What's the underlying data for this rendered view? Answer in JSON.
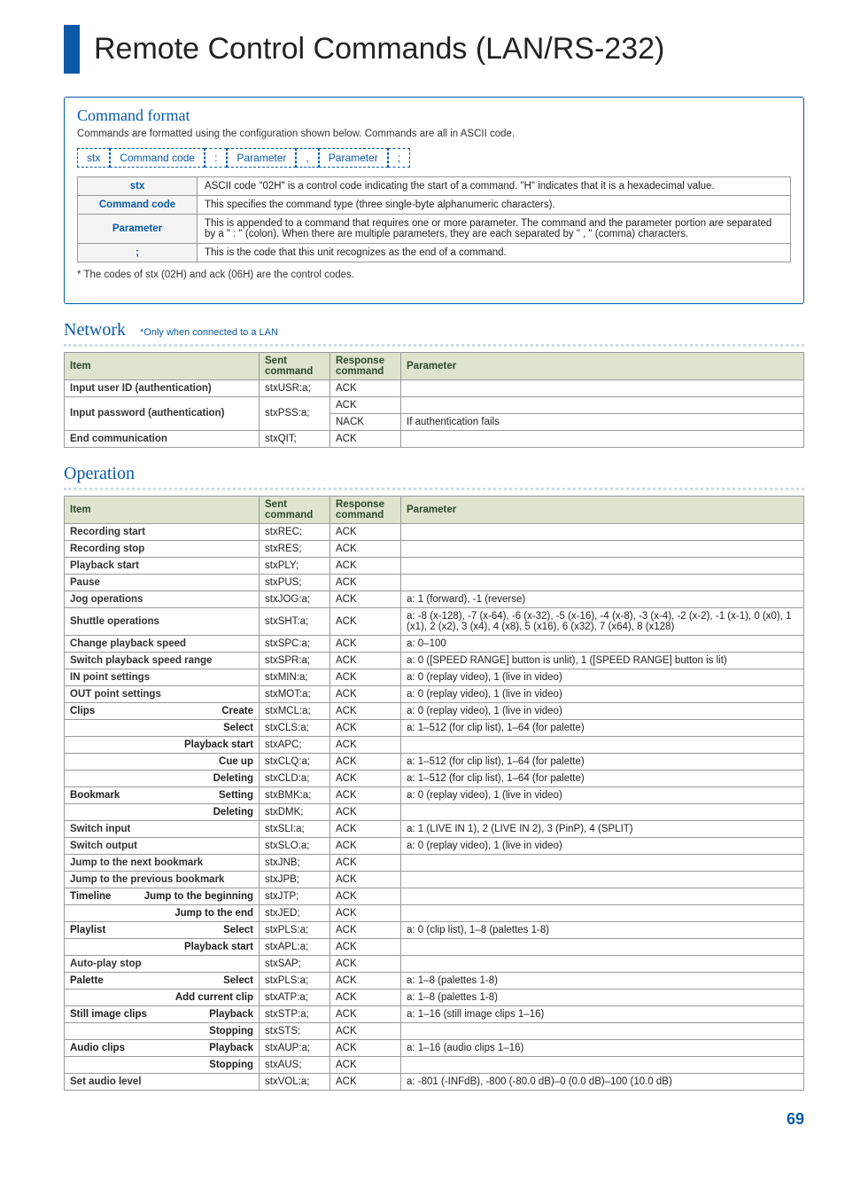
{
  "page_title": "Remote Control Commands (LAN/RS-232)",
  "page_number": "69",
  "cmd_format": {
    "heading": "Command format",
    "desc": "Commands are formatted using the configuration shown below. Commands are all in ASCII code.",
    "tokens": [
      "stx",
      "Command code",
      ":",
      "Parameter",
      ",",
      "Parameter",
      ";"
    ],
    "rows": [
      {
        "label": "stx",
        "text": "ASCII code \"02H\" is a control code indicating the start of a command. \"H\" indicates that it is a hexadecimal value."
      },
      {
        "label": "Command code",
        "text": "This specifies the command type (three single-byte alphanumeric characters)."
      },
      {
        "label": "Parameter",
        "text": "This is appended to a command that requires one or more parameter. The command and the parameter portion are separated by a \" : \" (colon). When there are multiple parameters, they are each separated by \" , \" (comma) characters."
      },
      {
        "label": ";",
        "text": "This is the code that this unit recognizes as the end of a command."
      }
    ],
    "footnote": "* The codes of stx (02H) and ack (06H) are the control codes."
  },
  "network": {
    "heading": "Network",
    "note": "*Only when connected to a LAN",
    "headers": [
      "Item",
      "Sent command",
      "Response command",
      "Parameter"
    ],
    "rows": [
      {
        "item": "Input user ID (authentication)",
        "sent": "stxUSR:a;",
        "resp": "ACK",
        "param": "",
        "rowspan": 1
      },
      {
        "item": "Input password (authentication)",
        "sent": "stxPSS:a;",
        "resp_rows": [
          {
            "resp": "ACK",
            "param": ""
          },
          {
            "resp": "NACK",
            "param": "If authentication fails"
          }
        ]
      },
      {
        "item": "End communication",
        "sent": "stxQIT;",
        "resp": "ACK",
        "param": "",
        "rowspan": 1
      }
    ]
  },
  "operation": {
    "heading": "Operation",
    "headers": [
      "Item",
      "Sent command",
      "Response command",
      "Parameter"
    ],
    "rows": [
      {
        "lead": "Recording start",
        "sub": "",
        "sent": "stxREC;",
        "resp": "ACK",
        "param": ""
      },
      {
        "lead": "Recording stop",
        "sub": "",
        "sent": "stxRES;",
        "resp": "ACK",
        "param": ""
      },
      {
        "lead": "Playback start",
        "sub": "",
        "sent": "stxPLY;",
        "resp": "ACK",
        "param": ""
      },
      {
        "lead": "Pause",
        "sub": "",
        "sent": "stxPUS;",
        "resp": "ACK",
        "param": ""
      },
      {
        "lead": "Jog operations",
        "sub": "",
        "sent": "stxJOG:a;",
        "resp": "ACK",
        "param": "a:  1 (forward), -1 (reverse)"
      },
      {
        "lead": "Shuttle operations",
        "sub": "",
        "sent": "stxSHT:a;",
        "resp": "ACK",
        "param": "a:  -8 (x-128), -7 (x-64), -6 (x-32), -5 (x-16), -4 (x-8), -3 (x-4), -2 (x-2), -1 (x-1), 0 (x0), 1 (x1), 2 (x2), 3 (x4), 4 (x8), 5 (x16), 6 (x32), 7 (x64), 8 (x128)"
      },
      {
        "lead": "Change playback speed",
        "sub": "",
        "sent": "stxSPC:a;",
        "resp": "ACK",
        "param": "a:  0–100"
      },
      {
        "lead": "Switch playback speed range",
        "sub": "",
        "sent": "stxSPR:a;",
        "resp": "ACK",
        "param": "a:  0 ([SPEED RANGE] button is unlit), 1 ([SPEED RANGE] button is lit)"
      },
      {
        "lead": "IN point settings",
        "sub": "",
        "sent": "stxMIN:a;",
        "resp": "ACK",
        "param": "a:  0 (replay video), 1 (live in video)"
      },
      {
        "lead": "OUT point settings",
        "sub": "",
        "sent": "stxMOT:a;",
        "resp": "ACK",
        "param": "a:  0 (replay video), 1 (live in video)"
      },
      {
        "lead": "Clips",
        "sub": "Create",
        "sent": "stxMCL:a;",
        "resp": "ACK",
        "param": "a:  0 (replay video), 1 (live in video)"
      },
      {
        "lead": "",
        "sub": "Select",
        "sent": "stxCLS:a;",
        "resp": "ACK",
        "param": "a:  1–512 (for clip list), 1–64 (for palette)"
      },
      {
        "lead": "",
        "sub": "Playback start",
        "sent": "stxAPC;",
        "resp": "ACK",
        "param": ""
      },
      {
        "lead": "",
        "sub": "Cue up",
        "sent": "stxCLQ:a;",
        "resp": "ACK",
        "param": "a:  1–512 (for clip list), 1–64 (for palette)"
      },
      {
        "lead": "",
        "sub": "Deleting",
        "sent": "stxCLD:a;",
        "resp": "ACK",
        "param": "a:  1–512 (for clip list), 1–64 (for palette)"
      },
      {
        "lead": "Bookmark",
        "sub": "Setting",
        "sent": "stxBMK:a;",
        "resp": "ACK",
        "param": "a:  0 (replay video), 1 (live in video)"
      },
      {
        "lead": "",
        "sub": "Deleting",
        "sent": "stxDMK;",
        "resp": "ACK",
        "param": ""
      },
      {
        "lead": "Switch input",
        "sub": "",
        "sent": "stxSLI:a;",
        "resp": "ACK",
        "param": "a:  1 (LIVE IN 1), 2 (LIVE IN 2), 3 (PinP), 4 (SPLIT)"
      },
      {
        "lead": "Switch output",
        "sub": "",
        "sent": "stxSLO:a;",
        "resp": "ACK",
        "param": "a:  0 (replay video), 1 (live in video)"
      },
      {
        "lead": "Jump to the next bookmark",
        "sub": "",
        "sent": "stxJNB;",
        "resp": "ACK",
        "param": ""
      },
      {
        "lead": "Jump to the previous bookmark",
        "sub": "",
        "sent": "stxJPB;",
        "resp": "ACK",
        "param": ""
      },
      {
        "lead": "Timeline",
        "sub": "Jump to the beginning",
        "sent": "stxJTP;",
        "resp": "ACK",
        "param": ""
      },
      {
        "lead": "",
        "sub": "Jump to the end",
        "sent": "stxJED;",
        "resp": "ACK",
        "param": ""
      },
      {
        "lead": "Playlist",
        "sub": "Select",
        "sent": "stxPLS:a;",
        "resp": "ACK",
        "param": "a:  0 (clip list), 1–8 (palettes 1-8)"
      },
      {
        "lead": "",
        "sub": "Playback start",
        "sent": "stxAPL:a;",
        "resp": "ACK",
        "param": ""
      },
      {
        "lead": "Auto-play stop",
        "sub": "",
        "sent": "stxSAP;",
        "resp": "ACK",
        "param": ""
      },
      {
        "lead": "Palette",
        "sub": "Select",
        "sent": "stxPLS:a;",
        "resp": "ACK",
        "param": "a:  1–8 (palettes 1-8)"
      },
      {
        "lead": "",
        "sub": "Add current clip",
        "sent": "stxATP:a;",
        "resp": "ACK",
        "param": "a:  1–8 (palettes 1-8)"
      },
      {
        "lead": "Still image clips",
        "sub": "Playback",
        "sent": "stxSTP:a;",
        "resp": "ACK",
        "param": "a:  1–16 (still image clips 1–16)"
      },
      {
        "lead": "",
        "sub": "Stopping",
        "sent": "stxSTS;",
        "resp": "ACK",
        "param": ""
      },
      {
        "lead": "Audio clips",
        "sub": "Playback",
        "sent": "stxAUP:a;",
        "resp": "ACK",
        "param": "a:  1–16 (audio clips 1–16)"
      },
      {
        "lead": "",
        "sub": "Stopping",
        "sent": "stxAUS;",
        "resp": "ACK",
        "param": ""
      },
      {
        "lead": "Set audio level",
        "sub": "",
        "sent": "stxVOL:a;",
        "resp": "ACK",
        "param": "a:  -801 (-INFdB), -800 (-80.0 dB)–0 (0.0 dB)–100 (10.0 dB)"
      }
    ]
  }
}
